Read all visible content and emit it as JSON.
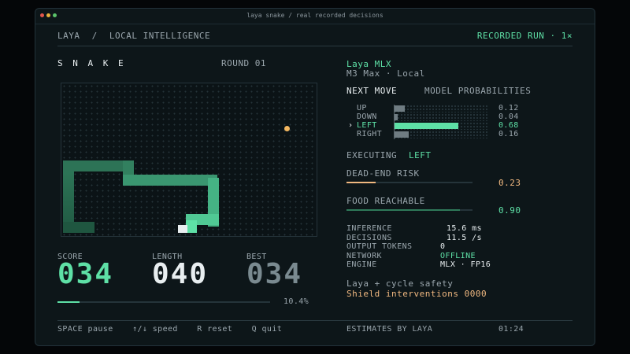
{
  "window": {
    "title": "laya snake  /  real recorded decisions",
    "dot_colors": [
      "#e2564c",
      "#e8b23c",
      "#5ac26a"
    ]
  },
  "header": {
    "brand": "LAYA",
    "separator": "/",
    "section": "LOCAL INTELLIGENCE",
    "run_label": "RECORDED RUN · 1×"
  },
  "game": {
    "title": "S N A K E",
    "round": "ROUND 01"
  },
  "stats": {
    "score_label": "SCORE",
    "score_value": "034",
    "length_label": "LENGTH",
    "length_value": "040",
    "best_label": "BEST",
    "best_value": "034",
    "progress_text": "10.4%",
    "progress_value": 0.104
  },
  "model": {
    "name": "Laya MLX",
    "subtitle": "M3 Max · Local"
  },
  "next_move": {
    "label": "NEXT MOVE",
    "probs_label": "MODEL PROBABILITIES",
    "rows": [
      {
        "marker": "",
        "dir": "UP",
        "value": "0.12",
        "p": 0.12
      },
      {
        "marker": "",
        "dir": "DOWN",
        "value": "0.04",
        "p": 0.04
      },
      {
        "marker": "›",
        "dir": "LEFT",
        "value": "0.68",
        "p": 0.68
      },
      {
        "marker": "",
        "dir": "RIGHT",
        "value": "0.16",
        "p": 0.16
      }
    ]
  },
  "executing": {
    "label": "EXECUTING",
    "value": "LEFT"
  },
  "dead_end": {
    "label": "DEAD-END RISK",
    "value": "0.23",
    "level": 0.23
  },
  "food": {
    "label": "FOOD REACHABLE",
    "value": "0.90",
    "level": 0.9
  },
  "metrics": [
    {
      "key": "INFERENCE",
      "value": "15.6 ms"
    },
    {
      "key": "DECISIONS",
      "value": "11.5 /s"
    },
    {
      "key": "OUTPUT TOKENS",
      "value": "0"
    },
    {
      "key": "NETWORK",
      "value": "OFFLINE"
    },
    {
      "key": "ENGINE",
      "value": "MLX · FP16"
    }
  ],
  "safety": {
    "line1": "Laya + cycle safety",
    "line2": "Shield interventions  0000"
  },
  "footer": {
    "space": "SPACE pause",
    "arrows": "↑/↓ speed",
    "reset": "R reset",
    "quit": "Q quit",
    "estimates": "ESTIMATES BY LAYA",
    "time": "01:24"
  },
  "colors": {
    "accent": "#5ee0a6",
    "warn": "#f0b880",
    "food": "#f3b760"
  }
}
